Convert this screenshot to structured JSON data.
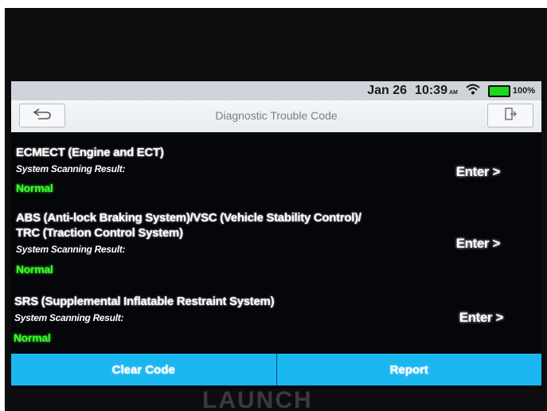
{
  "status": {
    "date": "Jan 26",
    "time": "10:39",
    "ampm": "AM",
    "battery": "100%",
    "colors": {
      "bar": "#cfd3da",
      "battery": "#1ed61e"
    }
  },
  "header": {
    "title": "Diagnostic Trouble Code",
    "back_icon": "back-arrow-icon",
    "exit_icon": "exit-door-icon"
  },
  "systems": [
    {
      "name_lines": [
        "ECMECT (Engine and ECT)"
      ],
      "scan_label": "System Scanning Result:",
      "scan_value": "Normal",
      "enter_label": "Enter >"
    },
    {
      "name_lines": [
        "ABS (Anti-lock Braking System)/VSC (Vehicle Stability Control)/",
        "TRC (Traction Control System)"
      ],
      "scan_label": "System Scanning Result:",
      "scan_value": "Normal",
      "enter_label": "Enter >"
    },
    {
      "name_lines": [
        "SRS (Supplemental Inflatable Restraint System)"
      ],
      "scan_label": "System Scanning Result:",
      "scan_value": "Normal",
      "enter_label": "Enter >"
    }
  ],
  "actions": {
    "clear_code": "Clear Code",
    "report": "Report",
    "color": "#1ab6f0"
  },
  "colors": {
    "normal": "#3aff2a",
    "screen_bg": "#05060a"
  },
  "brand": "LAUNCH"
}
